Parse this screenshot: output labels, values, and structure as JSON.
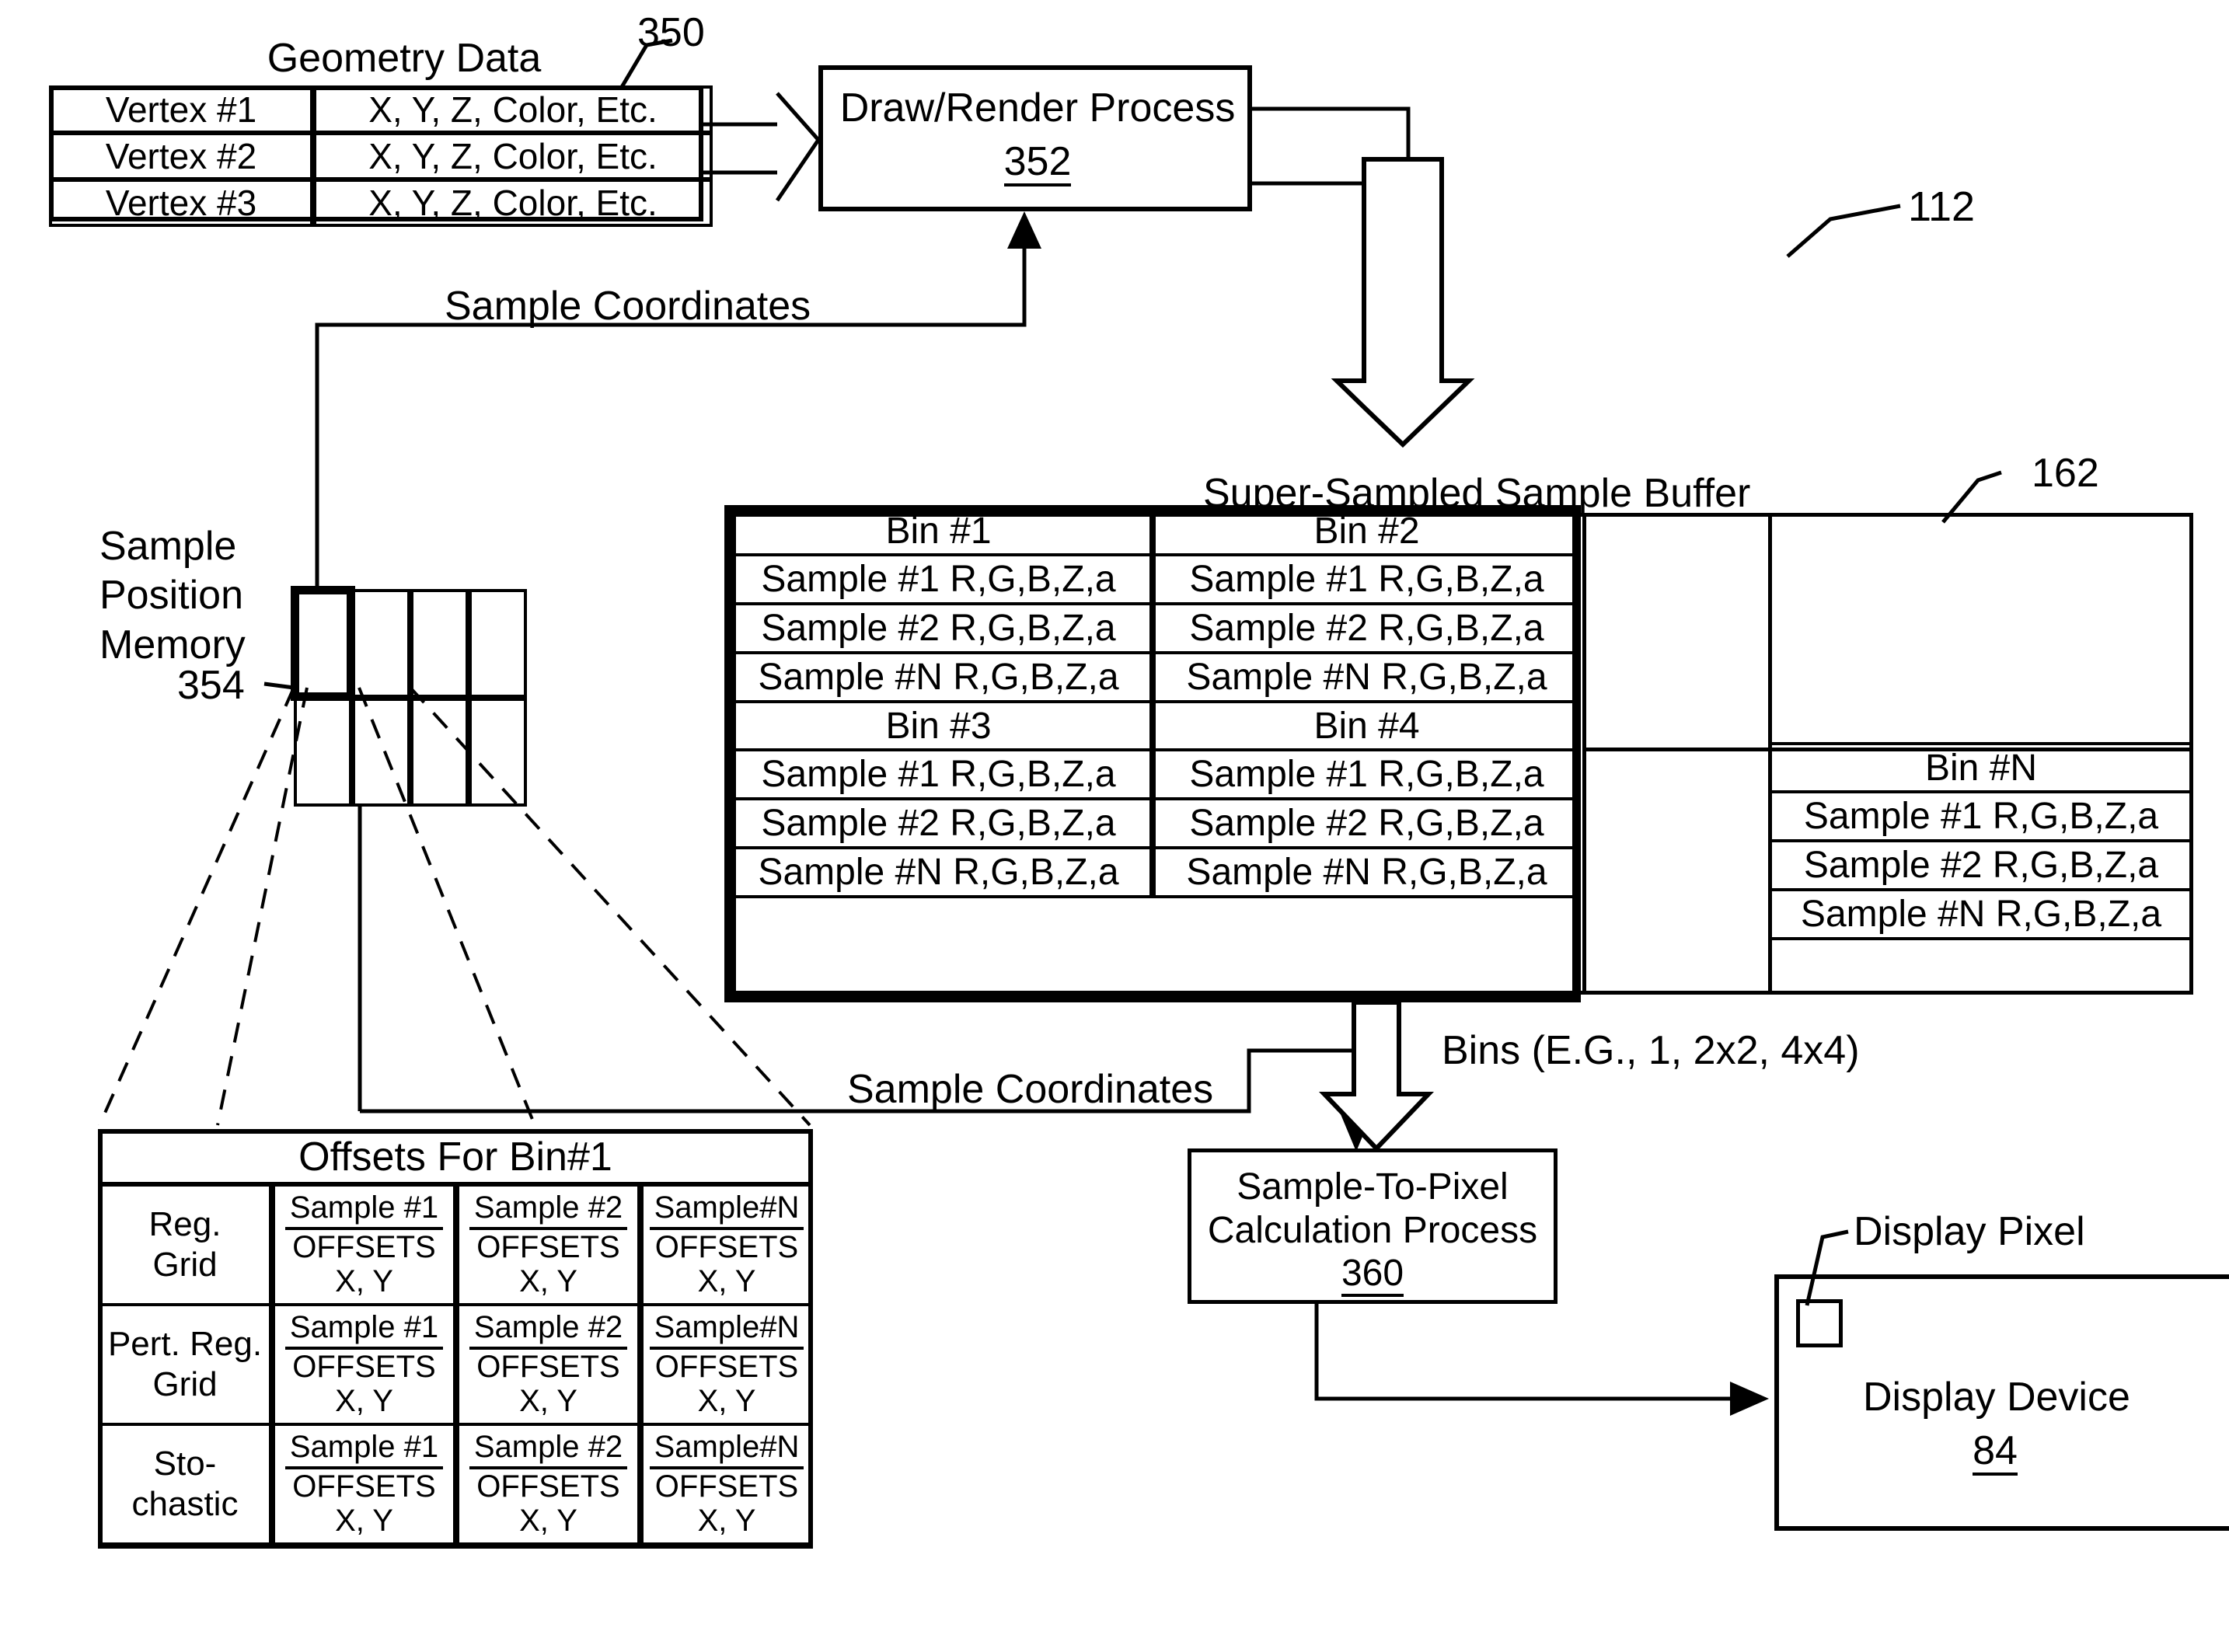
{
  "figure": {
    "ref_main": "112",
    "ref_geometry": "350",
    "ref_buffer": "162"
  },
  "geometry_data": {
    "title": "Geometry Data",
    "rows": [
      {
        "vertex": "Vertex #1",
        "attrs": "X, Y, Z, Color, Etc."
      },
      {
        "vertex": "Vertex #2",
        "attrs": "X, Y, Z, Color, Etc."
      },
      {
        "vertex": "Vertex #3",
        "attrs": "X, Y, Z, Color, Etc."
      }
    ]
  },
  "draw_render": {
    "title": "Draw/Render Process",
    "ref": "352"
  },
  "sample_position_memory": {
    "label_line1": "Sample",
    "label_line2": "Position",
    "label_line3": "Memory",
    "ref": "354"
  },
  "edges": {
    "sample_coordinates_top": "Sample Coordinates",
    "sample_coordinates_bottom": "Sample Coordinates",
    "bins_note": "Bins (E.G., 1, 2x2, 4x4)"
  },
  "sample_buffer": {
    "title": "Super-Sampled Sample Buffer",
    "bins": [
      {
        "name": "Bin #1",
        "samples": [
          "Sample #1 R,G,B,Z,a",
          "Sample #2 R,G,B,Z,a",
          "Sample #N R,G,B,Z,a"
        ]
      },
      {
        "name": "Bin #2",
        "samples": [
          "Sample #1 R,G,B,Z,a",
          "Sample #2 R,G,B,Z,a",
          "Sample #N R,G,B,Z,a"
        ]
      },
      {
        "name": "Bin #3",
        "samples": [
          "Sample #1 R,G,B,Z,a",
          "Sample #2 R,G,B,Z,a",
          "Sample #N R,G,B,Z,a"
        ]
      },
      {
        "name": "Bin #4",
        "samples": [
          "Sample #1 R,G,B,Z,a",
          "Sample #2 R,G,B,Z,a",
          "Sample #N R,G,B,Z,a"
        ]
      },
      {
        "name": "Bin #N",
        "samples": [
          "Sample #1 R,G,B,Z,a",
          "Sample #2 R,G,B,Z,a",
          "Sample #N R,G,B,Z,a"
        ]
      }
    ]
  },
  "offsets_table": {
    "title": "Offsets For Bin#1",
    "row_labels": [
      "Reg. Grid",
      "Pert. Reg. Grid",
      "Sto- chastic"
    ],
    "row_labels_split": [
      [
        "Reg.",
        "Grid"
      ],
      [
        "Pert. Reg.",
        "Grid"
      ],
      [
        "Sto-",
        "chastic"
      ]
    ],
    "column_headers": [
      "Sample #1",
      "Sample #2",
      "Sample#N"
    ],
    "cell_mid": "OFFSETS",
    "cell_bottom": "X, Y"
  },
  "sample_to_pixel": {
    "line1": "Sample-To-Pixel",
    "line2": "Calculation Process",
    "ref": "360"
  },
  "display": {
    "pixel_label": "Display Pixel",
    "device_label": "Display Device",
    "ref": "84"
  },
  "colors": {
    "ink": "#000000",
    "paper": "#ffffff"
  }
}
